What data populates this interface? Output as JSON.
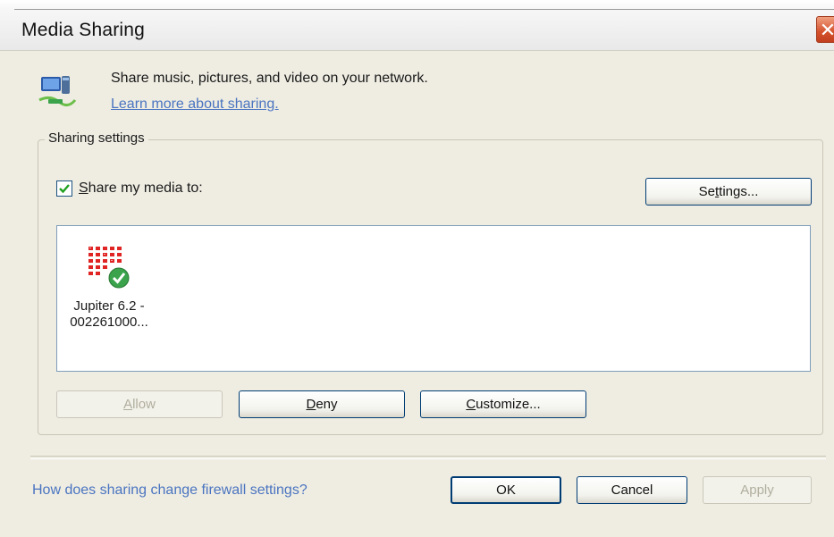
{
  "window": {
    "title": "Media Sharing"
  },
  "header": {
    "description": "Share music, pictures, and video on your network.",
    "learn_more_link": "Learn more about sharing."
  },
  "sharing_settings": {
    "group_label": "Sharing settings",
    "share_checkbox": {
      "checked": true,
      "label_first": "S",
      "label_rest": "hare my media to:"
    },
    "settings_button": {
      "pre": "Se",
      "key": "t",
      "post": "tings..."
    },
    "devices": [
      {
        "name_line1": "Jupiter 6.2 -",
        "name_line2": "002261000...",
        "icon": "media-device-icon",
        "status": "allowed"
      }
    ],
    "allow_button": {
      "key": "A",
      "post": "llow",
      "enabled": false
    },
    "deny_button": {
      "key": "D",
      "post": "eny"
    },
    "customize_button": {
      "key": "C",
      "post": "ustomize..."
    }
  },
  "footer": {
    "firewall_link": "How does sharing change firewall settings?",
    "ok_label": "OK",
    "cancel_label": "Cancel",
    "apply_label": "Apply"
  },
  "colors": {
    "dialog_bg": "#efede2",
    "link": "#4a74c0",
    "button_border": "#003c74",
    "close_button": "#d4512b"
  }
}
